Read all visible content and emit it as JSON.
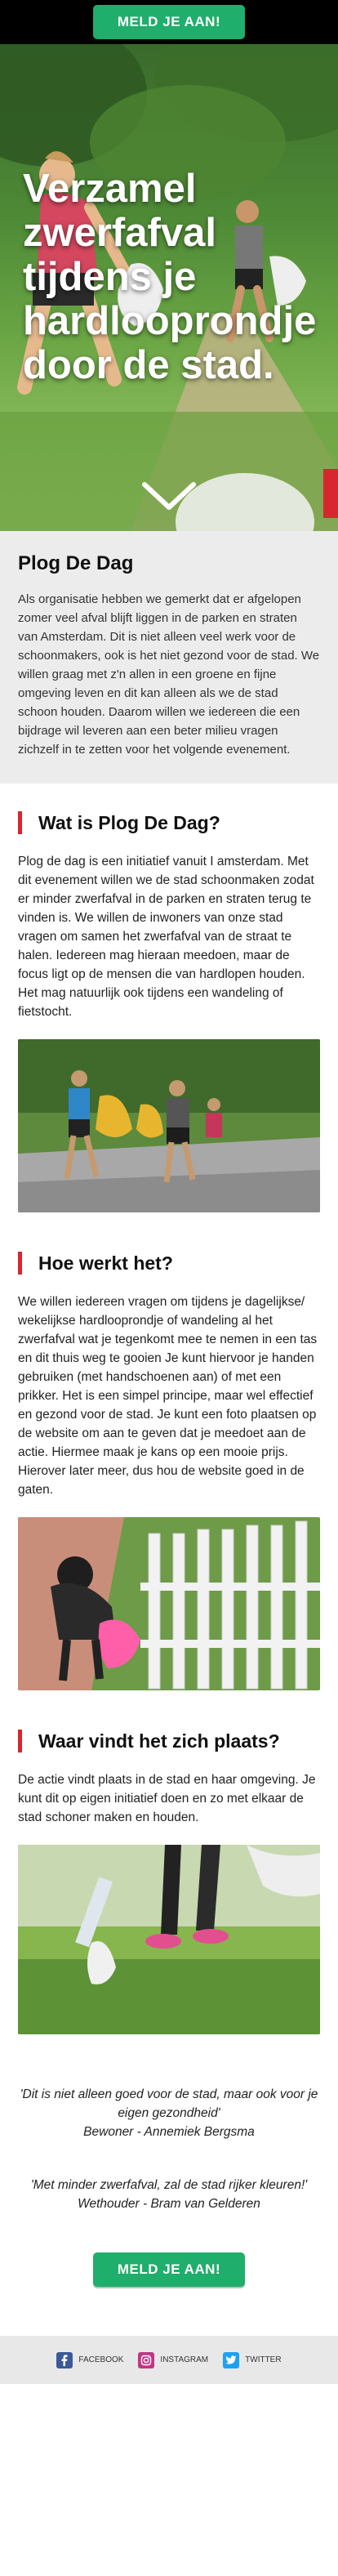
{
  "header": {
    "cta_label": "MELD JE AAN!"
  },
  "hero": {
    "title": "Verzamel zwerfafval tijdens je hardlooprondje door de stad."
  },
  "intro": {
    "title": "Plog De Dag",
    "text": "Als organisatie hebben we gemerkt dat er afgelopen zomer veel afval blijft liggen in de parken en straten van Amsterdam. Dit is niet alleen veel werk voor de schoonmakers, ook is het niet gezond voor de stad. We willen graag met z'n allen in een groene en fijne omgeving leven en dit kan alleen als we de stad schoon houden. Daarom willen we iedereen die een bijdrage wil leveren aan een beter milieu vragen zichzelf in te zetten voor het volgende evenement."
  },
  "sections": [
    {
      "title": "Wat is Plog De Dag?",
      "text": "Plog de dag is een initiatief vanuit I amsterdam. Met dit evenement willen we de stad schoonmaken zodat er minder zwerfafval in de parken en straten terug te vinden is. We willen de inwoners van onze stad vragen om samen het zwerfafval van de straat te halen. Iedereen mag hieraan meedoen, maar de focus ligt op de mensen die van hardlopen houden. Het mag natuurlijk ook tijdens een wandeling of fietstocht."
    },
    {
      "title": "Hoe werkt het?",
      "text": "We willen iedereen vragen om tijdens je dagelijkse/ wekelijkse hardlooprondje of wandeling al het zwerfafval wat je tegenkomt mee te nemen in een tas en dit thuis weg te gooien Je kunt hiervoor je handen gebruiken (met handschoenen aan) of met een prikker. Het is een simpel principe, maar wel effectief en gezond voor de stad. Je kunt een foto plaatsen op de website om aan te geven dat je meedoet aan de actie. Hiermee maak je kans op een mooie prijs. Hierover later meer, dus hou de website goed in de gaten."
    },
    {
      "title": "Waar vindt het zich plaats?",
      "text": "De actie vindt plaats in de stad en haar omgeving. Je kunt dit op eigen initiatief doen en zo met elkaar de stad schoner maken en houden."
    }
  ],
  "quotes": [
    {
      "text": "'Dit is niet alleen goed voor de stad, maar ook voor je eigen gezondheid'",
      "author": "Bewoner - Annemiek Bergsma"
    },
    {
      "text": "'Met minder zwerfafval, zal de stad rijker kleuren!'",
      "author": "Wethouder - Bram van Gelderen"
    }
  ],
  "bottom_cta": {
    "label": "MELD JE AAN!"
  },
  "footer": {
    "links": [
      {
        "label": "FACEBOOK",
        "icon": "facebook-icon",
        "color": "#3b5998"
      },
      {
        "label": "INSTAGRAM",
        "icon": "instagram-icon",
        "color": "#c13584"
      },
      {
        "label": "TWITTER",
        "icon": "twitter-icon",
        "color": "#1da1f2"
      }
    ]
  },
  "colors": {
    "accent_green": "#1fae6b",
    "accent_red": "#d8262e",
    "intro_bg": "#ececec",
    "footer_bg": "#e8e8e8"
  }
}
